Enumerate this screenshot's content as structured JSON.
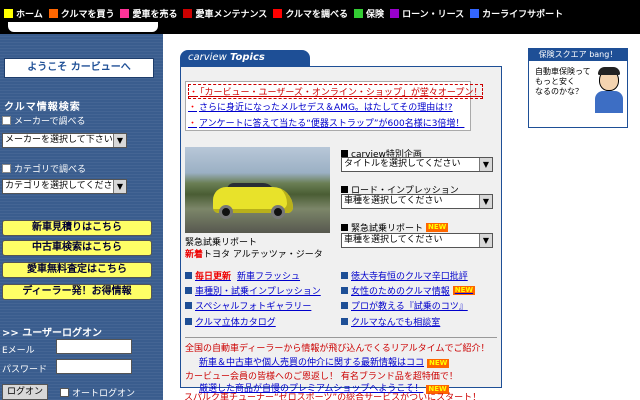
{
  "topnav": {
    "items": [
      {
        "label": "ホーム",
        "color": "#ffff00"
      },
      {
        "label": "クルマを買う",
        "color": "#ff6600"
      },
      {
        "label": "愛車を売る",
        "color": "#ff3399"
      },
      {
        "label": "愛車メンテナンス",
        "color": "#cc0000"
      },
      {
        "label": "クルマを調べる",
        "color": "#ff0000"
      },
      {
        "label": "保険",
        "color": "#33cc33"
      },
      {
        "label": "ローン・リース",
        "color": "#9900cc"
      },
      {
        "label": "カーライフサポート",
        "color": "#3366ff"
      }
    ]
  },
  "sidebar": {
    "welcome": "ようこそ カービューへ",
    "search_title": "クルマ情報検索",
    "maker_radio": "メーカーで調べる",
    "maker_select": "メーカーを選択して下さい",
    "category_radio": "カテゴリで調べる",
    "category_select": "カテゴリを選択してください",
    "buttons": [
      "新車見積りはこちら",
      "中古車検索はこちら",
      "愛車無料査定はこちら",
      "ディーラー発！お得情報"
    ],
    "login_title": "ユーザーログオン",
    "email_label": "Eメール",
    "password_label": "パスワード",
    "login_button": "ログオン",
    "auto_login": "オートログオン"
  },
  "topics": {
    "tab_prefix": "carview",
    "tab_title": "Topics",
    "news": [
      "「カービュー・ユーザーズ・オンライン・ショップ」が堂々オープン！",
      "さらに身近になったメルセデス＆AMG。はたしてその理由は!?",
      "アンケートに答えて当たる“便器ストラップ”が600名様に3倍増！"
    ],
    "photo_caption1": "緊急試乗リポート",
    "photo_new": "新着",
    "photo_caption2": "トヨタ アルテッツァ・ジータ",
    "special_label": "carview特別企画",
    "special_select": "タイトルを選択してください",
    "road_label": "ロード・インプレッション",
    "road_select": "車種を選択してください",
    "urgent_label": "緊急試乗リポート",
    "urgent_new": "NEW",
    "urgent_select": "車種を選択してください",
    "links_left": [
      {
        "prefix": "毎日更新",
        "text": "新車フラッシュ"
      },
      {
        "prefix": "",
        "text": "車種別・試乗インプレッション"
      },
      {
        "prefix": "",
        "text": "スペシャルフォトギャラリー"
      },
      {
        "prefix": "",
        "text": "クルマ立体カタログ"
      }
    ],
    "links_right": [
      {
        "text": "徳大寺有恒のクルマ辛口批評",
        "new": ""
      },
      {
        "text": "女性のためのクルマ情報",
        "new": "NEW"
      },
      {
        "text": "プロが教える『試乗のコツ』",
        "new": ""
      },
      {
        "text": "クルマなんでも相談室",
        "new": ""
      }
    ],
    "bottom": [
      {
        "text": "全国の自動車ディーラーから情報が飛び込んでくるリアルタイムでご紹介！",
        "color": "#cc0000"
      },
      {
        "text": "新車＆中古車や個人売買の仲介に関する最新情報はココ",
        "color": "#0000cc",
        "new": "NEW"
      },
      {
        "text": "カービュー会員の皆様へのご恩返し！ 有名ブランド品を超特価で！",
        "color": "#cc0000"
      },
      {
        "text": "厳選した商品が自慢のプレミアムショップへようこそ！",
        "color": "#0000cc",
        "new": "NEW"
      },
      {
        "text": "スパルク車チューナー“ゼロスポーツ”の総合サービスがついにスタート！",
        "color": "#cc0000"
      }
    ]
  },
  "ad": {
    "header": "保険スクエア bang！",
    "lines": [
      "自動車保険って",
      "もっと安く",
      "なるのかな？"
    ]
  }
}
